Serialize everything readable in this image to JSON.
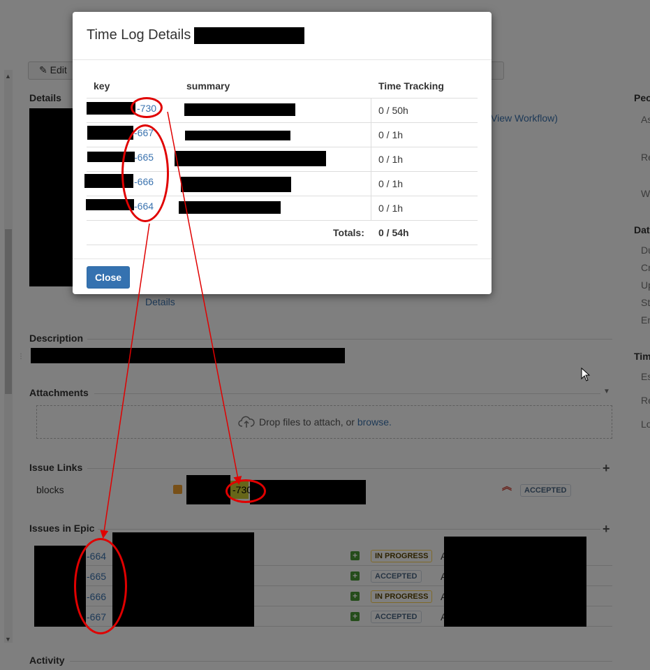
{
  "background": {
    "edit_label": "Edit",
    "details_link": "Details",
    "workflow_link": "View Workflow)",
    "sections": {
      "details": "Details",
      "description": "Description",
      "attachments": "Attachments",
      "issue_links": "Issue Links",
      "issues_in_epic": "Issues in Epic",
      "activity": "Activity"
    },
    "dropzone": {
      "text": "Drop files to attach, or ",
      "link": "browse."
    },
    "issue_links": {
      "relation": "blocks",
      "key": "-730",
      "status": "ACCEPTED"
    },
    "epic_issues": [
      {
        "key": "-664",
        "status": "IN PROGRESS",
        "trail": "A"
      },
      {
        "key": "-665",
        "status": "ACCEPTED",
        "trail": "A"
      },
      {
        "key": "-666",
        "status": "IN PROGRESS",
        "trail": "A"
      },
      {
        "key": "-667",
        "status": "ACCEPTED",
        "trail": "A"
      }
    ],
    "right_column": {
      "people_h": "Peo",
      "people_items": [
        "As",
        "Re",
        "W"
      ],
      "dates_h": "Dat",
      "dates_items": [
        "Du",
        "Cr",
        "Up",
        "St",
        "En"
      ],
      "time_h": "Tim",
      "time_items": [
        "Es",
        "Re",
        "Lo"
      ]
    }
  },
  "modal": {
    "title": "Time Log Details",
    "columns": {
      "key": "key",
      "summary": "summary",
      "time": "Time Tracking"
    },
    "rows": [
      {
        "key": "-730",
        "time": "0 / 50h"
      },
      {
        "key": "-667",
        "time": "0 / 1h"
      },
      {
        "key": "-665",
        "time": "0 / 1h"
      },
      {
        "key": "-666",
        "time": "0 / 1h"
      },
      {
        "key": "-664",
        "time": "0 / 1h"
      }
    ],
    "totals_label": "Totals:",
    "totals_value": "0 / 54h",
    "close_label": "Close"
  },
  "colors": {
    "link": "#3b73af",
    "annotation": "#e00000",
    "primary_button": "#3572b0"
  },
  "icons": [
    "edit-icon",
    "cloud-upload-icon",
    "lightbulb-icon",
    "priority-highest-icon",
    "add-icon",
    "mouse-cursor-icon"
  ]
}
